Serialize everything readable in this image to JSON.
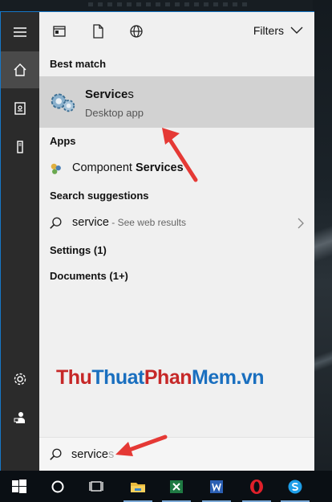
{
  "top_filters": {
    "filters_label": "Filters"
  },
  "sections": {
    "best_match": "Best match",
    "apps": "Apps",
    "search_suggestions": "Search suggestions",
    "settings": "Settings (1)",
    "documents": "Documents (1+)"
  },
  "best_match_item": {
    "title_bold": "Service",
    "title_rest": "s",
    "subtitle": "Desktop app"
  },
  "apps_item": {
    "label_plain": "Component ",
    "label_bold": "Services"
  },
  "suggestion_item": {
    "term": "service",
    "suffix": " - See web results"
  },
  "search": {
    "typed": "service",
    "ghost": "s"
  },
  "watermark": {
    "part1": "Thu",
    "part2": "Thuat",
    "part3": "Phan",
    "part4": "Mem.vn"
  },
  "colors": {
    "accent": "#1677c7",
    "selected_row": "#d2d2d2",
    "arrow": "#e53935"
  },
  "taskbar": {
    "icons": [
      "windows-start-icon",
      "cortana-icon",
      "task-view-icon",
      "file-explorer-icon",
      "excel-icon",
      "word-icon",
      "opera-icon",
      "skype-icon"
    ]
  }
}
